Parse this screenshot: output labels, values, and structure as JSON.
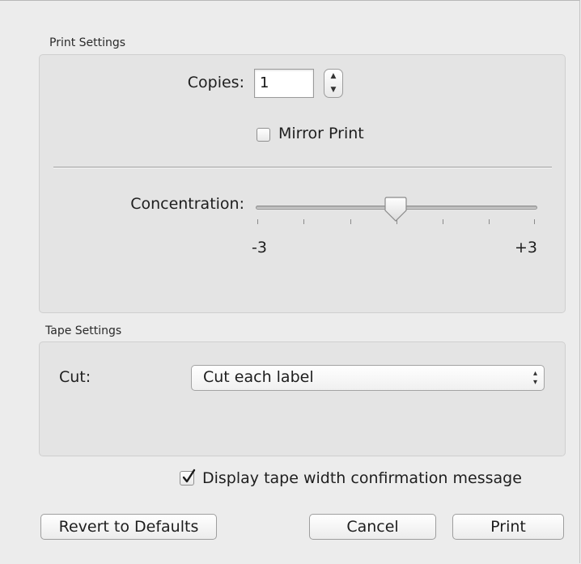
{
  "print_settings": {
    "section_label": "Print Settings",
    "copies_label": "Copies:",
    "copies_value": "1",
    "mirror_print_label": "Mirror Print",
    "mirror_print_checked": false,
    "concentration_label": "Concentration:",
    "concentration_min_label": "-3",
    "concentration_max_label": "+3",
    "concentration_value": 0
  },
  "tape_settings": {
    "section_label": "Tape Settings",
    "cut_label": "Cut:",
    "cut_selected": "Cut each label"
  },
  "options": {
    "display_tape_width_label": "Display tape width confirmation message",
    "display_tape_width_checked": true
  },
  "buttons": {
    "revert_label": "Revert to Defaults",
    "cancel_label": "Cancel",
    "print_label": "Print"
  }
}
